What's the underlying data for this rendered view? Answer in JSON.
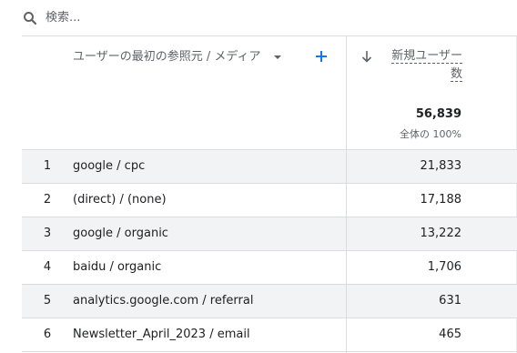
{
  "search": {
    "placeholder": "検索..."
  },
  "table": {
    "dimension_header": "ユーザーの最初の参照元 / メディア",
    "metric_header_line1": "新規ユーザー",
    "metric_header_line2": "数",
    "total_value": "56,839",
    "total_pct": "全体の 100%",
    "rows": [
      {
        "num": "1",
        "dimension": "google / cpc",
        "value": "21,833"
      },
      {
        "num": "2",
        "dimension": "(direct) / (none)",
        "value": "17,188"
      },
      {
        "num": "3",
        "dimension": "google / organic",
        "value": "13,222"
      },
      {
        "num": "4",
        "dimension": "baidu / organic",
        "value": "1,706"
      },
      {
        "num": "5",
        "dimension": "analytics.google.com / referral",
        "value": "631"
      },
      {
        "num": "6",
        "dimension": "Newsletter_April_2023 / email",
        "value": "465"
      }
    ]
  },
  "colors": {
    "accent": "#1a73e8",
    "row_shade": "#f1f3f4",
    "border": "#dadce0"
  }
}
